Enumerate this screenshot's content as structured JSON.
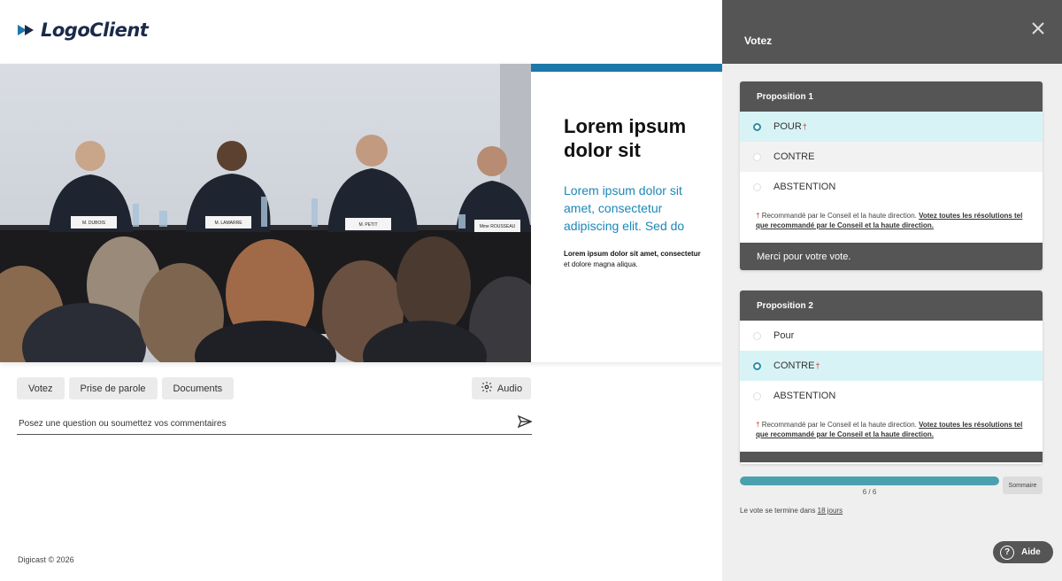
{
  "brand": {
    "logo_text": "LogoClient",
    "accent_color": "#1c78a8"
  },
  "slide": {
    "title": "Lorem ipsum dolor sit",
    "subtitle": "Lorem ipsum dolor sit amet, consectetur adipiscing elit. Sed do",
    "small_bold": "Lorem ipsum dolor sit amet, consectetur",
    "small_rest": " et dolore magna aliqua."
  },
  "photo": {
    "nameplates": [
      "M. DUBOIS",
      "M. LAMARRE",
      "M. PETIT",
      "Mme ROUSSEAU"
    ]
  },
  "tabs": [
    {
      "label": "Votez"
    },
    {
      "label": "Prise de parole"
    },
    {
      "label": "Documents"
    }
  ],
  "audio": {
    "label": "Audio",
    "icon": "gear-icon"
  },
  "question": {
    "placeholder": "Posez une question ou soumettez vos commentaires",
    "send_icon": "send-icon"
  },
  "footer": {
    "copyright": "Digicast © 2026"
  },
  "panel": {
    "title": "Votez",
    "close_icon": "close-icon",
    "propositions": [
      {
        "title": "Proposition 1",
        "options": [
          {
            "label": "POUR",
            "recommended": true,
            "selected": true
          },
          {
            "label": "CONTRE",
            "recommended": false,
            "selected": false
          },
          {
            "label": "ABSTENTION",
            "recommended": false,
            "selected": false
          }
        ],
        "note_text": "Recommandé par le Conseil et la haute direction.",
        "note_link": "Votez toutes les résolutions tel que recommandé par le Conseil et la haute direction.",
        "footer": "Merci pour votre vote."
      },
      {
        "title": "Proposition 2",
        "options": [
          {
            "label": "Pour",
            "recommended": false,
            "selected": false
          },
          {
            "label": "CONTRE",
            "recommended": true,
            "selected": true
          },
          {
            "label": "ABSTENTION",
            "recommended": false,
            "selected": false
          }
        ],
        "note_text": "Recommandé par le Conseil et la haute direction.",
        "note_link": "Votez toutes les résolutions tel que recommandé par le Conseil et la haute direction.",
        "footer": ""
      }
    ],
    "progress": {
      "value": 6,
      "total": 6,
      "label": "6 / 6",
      "fill_color": "#4aa0ae"
    },
    "summary_label": "Sommaire",
    "deadline_text": "Le vote se termine dans",
    "deadline_link": "18 jours"
  },
  "help": {
    "label": "Aide",
    "icon": "help-icon"
  }
}
